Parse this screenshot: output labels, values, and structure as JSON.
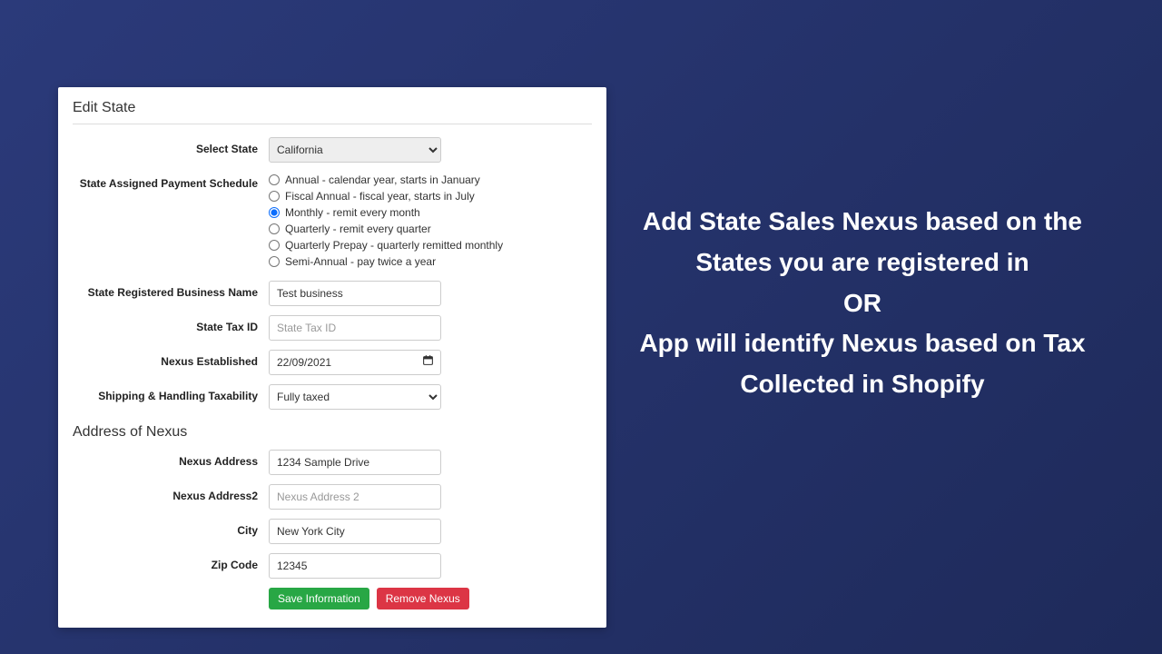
{
  "form": {
    "title": "Edit State",
    "select_state_label": "Select State",
    "select_state_value": "California",
    "schedule_label": "State Assigned Payment Schedule",
    "schedule_options": [
      "Annual - calendar year, starts in January",
      "Fiscal Annual - fiscal year, starts in July",
      "Monthly - remit every month",
      "Quarterly - remit every quarter",
      "Quarterly Prepay - quarterly remitted monthly",
      "Semi-Annual - pay twice a year"
    ],
    "schedule_selected_index": 2,
    "business_name_label": "State Registered Business Name",
    "business_name_value": "Test business",
    "tax_id_label": "State Tax ID",
    "tax_id_placeholder": "State Tax ID",
    "tax_id_value": "",
    "nexus_established_label": "Nexus Established",
    "nexus_established_value": "22/09/2021",
    "shipping_tax_label": "Shipping & Handling Taxability",
    "shipping_tax_value": "Fully taxed",
    "address_title": "Address of Nexus",
    "address_label": "Nexus Address",
    "address_value": "1234 Sample Drive",
    "address2_label": "Nexus Address2",
    "address2_placeholder": "Nexus Address 2",
    "address2_value": "",
    "city_label": "City",
    "city_value": "New York City",
    "zip_label": "Zip Code",
    "zip_value": "12345",
    "save_label": "Save Information",
    "remove_label": "Remove Nexus"
  },
  "promo": {
    "line1": "Add State Sales Nexus based on the States you are registered in",
    "line2": "OR",
    "line3": "App will identify Nexus based on Tax Collected in Shopify"
  }
}
